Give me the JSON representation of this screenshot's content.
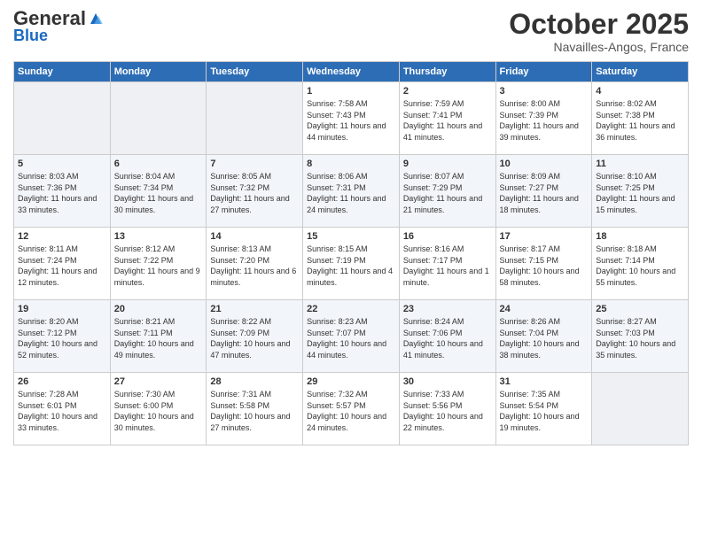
{
  "header": {
    "logo_general": "General",
    "logo_blue": "Blue",
    "month_title": "October 2025",
    "location": "Navailles-Angos, France"
  },
  "weekdays": [
    "Sunday",
    "Monday",
    "Tuesday",
    "Wednesday",
    "Thursday",
    "Friday",
    "Saturday"
  ],
  "weeks": [
    [
      {
        "day": "",
        "sunrise": "",
        "sunset": "",
        "daylight": ""
      },
      {
        "day": "",
        "sunrise": "",
        "sunset": "",
        "daylight": ""
      },
      {
        "day": "",
        "sunrise": "",
        "sunset": "",
        "daylight": ""
      },
      {
        "day": "1",
        "sunrise": "Sunrise: 7:58 AM",
        "sunset": "Sunset: 7:43 PM",
        "daylight": "Daylight: 11 hours and 44 minutes."
      },
      {
        "day": "2",
        "sunrise": "Sunrise: 7:59 AM",
        "sunset": "Sunset: 7:41 PM",
        "daylight": "Daylight: 11 hours and 41 minutes."
      },
      {
        "day": "3",
        "sunrise": "Sunrise: 8:00 AM",
        "sunset": "Sunset: 7:39 PM",
        "daylight": "Daylight: 11 hours and 39 minutes."
      },
      {
        "day": "4",
        "sunrise": "Sunrise: 8:02 AM",
        "sunset": "Sunset: 7:38 PM",
        "daylight": "Daylight: 11 hours and 36 minutes."
      }
    ],
    [
      {
        "day": "5",
        "sunrise": "Sunrise: 8:03 AM",
        "sunset": "Sunset: 7:36 PM",
        "daylight": "Daylight: 11 hours and 33 minutes."
      },
      {
        "day": "6",
        "sunrise": "Sunrise: 8:04 AM",
        "sunset": "Sunset: 7:34 PM",
        "daylight": "Daylight: 11 hours and 30 minutes."
      },
      {
        "day": "7",
        "sunrise": "Sunrise: 8:05 AM",
        "sunset": "Sunset: 7:32 PM",
        "daylight": "Daylight: 11 hours and 27 minutes."
      },
      {
        "day": "8",
        "sunrise": "Sunrise: 8:06 AM",
        "sunset": "Sunset: 7:31 PM",
        "daylight": "Daylight: 11 hours and 24 minutes."
      },
      {
        "day": "9",
        "sunrise": "Sunrise: 8:07 AM",
        "sunset": "Sunset: 7:29 PM",
        "daylight": "Daylight: 11 hours and 21 minutes."
      },
      {
        "day": "10",
        "sunrise": "Sunrise: 8:09 AM",
        "sunset": "Sunset: 7:27 PM",
        "daylight": "Daylight: 11 hours and 18 minutes."
      },
      {
        "day": "11",
        "sunrise": "Sunrise: 8:10 AM",
        "sunset": "Sunset: 7:25 PM",
        "daylight": "Daylight: 11 hours and 15 minutes."
      }
    ],
    [
      {
        "day": "12",
        "sunrise": "Sunrise: 8:11 AM",
        "sunset": "Sunset: 7:24 PM",
        "daylight": "Daylight: 11 hours and 12 minutes."
      },
      {
        "day": "13",
        "sunrise": "Sunrise: 8:12 AM",
        "sunset": "Sunset: 7:22 PM",
        "daylight": "Daylight: 11 hours and 9 minutes."
      },
      {
        "day": "14",
        "sunrise": "Sunrise: 8:13 AM",
        "sunset": "Sunset: 7:20 PM",
        "daylight": "Daylight: 11 hours and 6 minutes."
      },
      {
        "day": "15",
        "sunrise": "Sunrise: 8:15 AM",
        "sunset": "Sunset: 7:19 PM",
        "daylight": "Daylight: 11 hours and 4 minutes."
      },
      {
        "day": "16",
        "sunrise": "Sunrise: 8:16 AM",
        "sunset": "Sunset: 7:17 PM",
        "daylight": "Daylight: 11 hours and 1 minute."
      },
      {
        "day": "17",
        "sunrise": "Sunrise: 8:17 AM",
        "sunset": "Sunset: 7:15 PM",
        "daylight": "Daylight: 10 hours and 58 minutes."
      },
      {
        "day": "18",
        "sunrise": "Sunrise: 8:18 AM",
        "sunset": "Sunset: 7:14 PM",
        "daylight": "Daylight: 10 hours and 55 minutes."
      }
    ],
    [
      {
        "day": "19",
        "sunrise": "Sunrise: 8:20 AM",
        "sunset": "Sunset: 7:12 PM",
        "daylight": "Daylight: 10 hours and 52 minutes."
      },
      {
        "day": "20",
        "sunrise": "Sunrise: 8:21 AM",
        "sunset": "Sunset: 7:11 PM",
        "daylight": "Daylight: 10 hours and 49 minutes."
      },
      {
        "day": "21",
        "sunrise": "Sunrise: 8:22 AM",
        "sunset": "Sunset: 7:09 PM",
        "daylight": "Daylight: 10 hours and 47 minutes."
      },
      {
        "day": "22",
        "sunrise": "Sunrise: 8:23 AM",
        "sunset": "Sunset: 7:07 PM",
        "daylight": "Daylight: 10 hours and 44 minutes."
      },
      {
        "day": "23",
        "sunrise": "Sunrise: 8:24 AM",
        "sunset": "Sunset: 7:06 PM",
        "daylight": "Daylight: 10 hours and 41 minutes."
      },
      {
        "day": "24",
        "sunrise": "Sunrise: 8:26 AM",
        "sunset": "Sunset: 7:04 PM",
        "daylight": "Daylight: 10 hours and 38 minutes."
      },
      {
        "day": "25",
        "sunrise": "Sunrise: 8:27 AM",
        "sunset": "Sunset: 7:03 PM",
        "daylight": "Daylight: 10 hours and 35 minutes."
      }
    ],
    [
      {
        "day": "26",
        "sunrise": "Sunrise: 7:28 AM",
        "sunset": "Sunset: 6:01 PM",
        "daylight": "Daylight: 10 hours and 33 minutes."
      },
      {
        "day": "27",
        "sunrise": "Sunrise: 7:30 AM",
        "sunset": "Sunset: 6:00 PM",
        "daylight": "Daylight: 10 hours and 30 minutes."
      },
      {
        "day": "28",
        "sunrise": "Sunrise: 7:31 AM",
        "sunset": "Sunset: 5:58 PM",
        "daylight": "Daylight: 10 hours and 27 minutes."
      },
      {
        "day": "29",
        "sunrise": "Sunrise: 7:32 AM",
        "sunset": "Sunset: 5:57 PM",
        "daylight": "Daylight: 10 hours and 24 minutes."
      },
      {
        "day": "30",
        "sunrise": "Sunrise: 7:33 AM",
        "sunset": "Sunset: 5:56 PM",
        "daylight": "Daylight: 10 hours and 22 minutes."
      },
      {
        "day": "31",
        "sunrise": "Sunrise: 7:35 AM",
        "sunset": "Sunset: 5:54 PM",
        "daylight": "Daylight: 10 hours and 19 minutes."
      },
      {
        "day": "",
        "sunrise": "",
        "sunset": "",
        "daylight": ""
      }
    ]
  ]
}
